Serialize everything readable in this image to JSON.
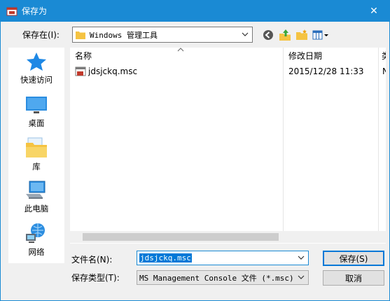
{
  "window": {
    "title": "保存为",
    "close_glyph": "✕"
  },
  "toolbar": {
    "save_in_label": "保存在(I):",
    "location": "Windows 管理工具",
    "icons": [
      "back-icon",
      "up-folder-icon",
      "new-folder-icon",
      "view-menu-icon"
    ]
  },
  "sidebar": {
    "items": [
      {
        "label": "快速访问",
        "icon": "quick-access-star-icon"
      },
      {
        "label": "桌面",
        "icon": "desktop-icon"
      },
      {
        "label": "库",
        "icon": "library-icon"
      },
      {
        "label": "此电脑",
        "icon": "this-pc-icon"
      },
      {
        "label": "网络",
        "icon": "network-icon"
      }
    ]
  },
  "filelist": {
    "columns": [
      "名称",
      "修改日期",
      "类"
    ],
    "files": [
      {
        "name": "jdsjckq.msc",
        "modified": "2015/12/28 11:33",
        "type_partial": "N"
      }
    ]
  },
  "form": {
    "filename_label": "文件名(N):",
    "filename_value": "jdsjckq.msc",
    "filetype_label": "保存类型(T):",
    "filetype_value": "MS Management Console 文件 (*.msc)",
    "save_button": "保存(S)",
    "cancel_button": "取消"
  },
  "colors": {
    "titlebar": "#1a8ad4",
    "selection": "#0078d7",
    "folder": "#f5c342"
  }
}
